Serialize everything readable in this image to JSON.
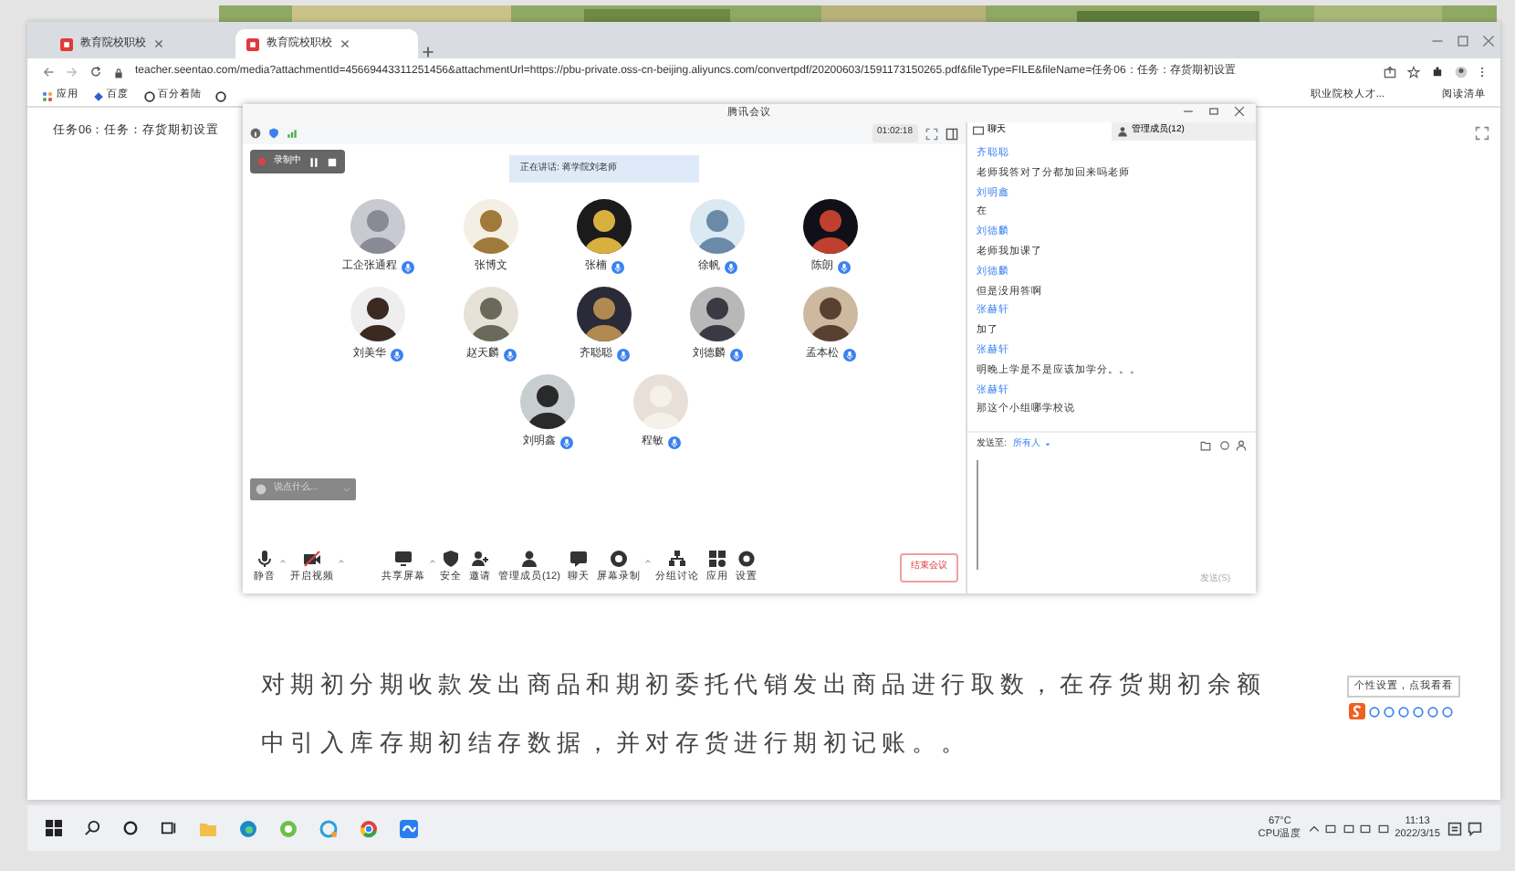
{
  "browser": {
    "tabs": [
      {
        "title": "教育院校职校",
        "selected": false
      },
      {
        "title": "教育院校职校",
        "selected": true
      }
    ],
    "url": "teacher.seentao.com/media?attachmentId=45669443311251456&attachmentUrl=https://pbu-private.oss-cn-beijing.aliyuncs.com/convertpdf/20200603/1591173150265.pdf&fileType=FILE&fileName=任务06：任务：存货期初设置",
    "bookmarks": [
      "应用",
      "百度",
      "百分着陆"
    ],
    "bookmarks_right": [
      "职业院校人才...",
      "阅读清单"
    ]
  },
  "page": {
    "title": "任务06：任务：存货期初设置",
    "paragraph_lines": [
      "对期初分期收款发出商品和期初委托代销发出商品进行取数，在存货期初余额",
      "中引入库存期初结存数据，并对存货进行期初记账。。"
    ]
  },
  "meeting": {
    "title": "腾讯会议",
    "timer": "01:02:18",
    "recording": "录制中",
    "speaking": "正在讲话: 蒋学院刘老师",
    "participants": [
      {
        "name": "工企张通程",
        "mic": true
      },
      {
        "name": "张博文",
        "mic": false
      },
      {
        "name": "张楠",
        "mic": true
      },
      {
        "name": "徐帆",
        "mic": true
      },
      {
        "name": "陈朗",
        "mic": true
      },
      {
        "name": "刘美华",
        "mic": true
      },
      {
        "name": "赵天麟",
        "mic": true
      },
      {
        "name": "齐聪聪",
        "mic": true
      },
      {
        "name": "刘德麟",
        "mic": true
      },
      {
        "name": "孟本松",
        "mic": true
      },
      {
        "name": "刘明鑫",
        "mic": true
      },
      {
        "name": "程敏",
        "mic": true
      }
    ],
    "chat_placeholder": "说点什么...",
    "toolbar_left": [
      {
        "label": "静音",
        "has_menu": true
      },
      {
        "label": "开启视频",
        "has_menu": true
      }
    ],
    "toolbar_center": [
      {
        "label": "共享屏幕",
        "has_menu": true
      },
      {
        "label": "安全",
        "has_menu": false
      },
      {
        "label": "邀请",
        "has_menu": false
      },
      {
        "label": "管理成员(12)",
        "has_menu": false
      },
      {
        "label": "聊天",
        "has_menu": false
      },
      {
        "label": "屏幕录制",
        "has_menu": true
      },
      {
        "label": "分组讨论",
        "has_menu": false
      },
      {
        "label": "应用",
        "has_menu": false
      },
      {
        "label": "设置",
        "has_menu": false
      }
    ],
    "end_button": "结束会议"
  },
  "chat": {
    "tabs": [
      {
        "label": "聊天",
        "selected": true
      },
      {
        "label": "管理成员(12)",
        "selected": false
      }
    ],
    "messages": [
      {
        "sender": "齐聪聪",
        "text": "老师我答对了分都加回来吗老师"
      },
      {
        "sender": "刘明鑫",
        "text": "在"
      },
      {
        "sender": "刘德麟",
        "text": "老师我加课了"
      },
      {
        "sender": "刘德麟",
        "text": "但是没用答啊"
      },
      {
        "sender": "张赫轩",
        "text": "加了"
      },
      {
        "sender": "张赫轩",
        "text": "明晚上学是不是应该加学分。。。"
      },
      {
        "sender": "张赫轩",
        "text": "那这个小组哪学校说"
      }
    ],
    "send_to_label": "发送至:",
    "send_to": "所有人",
    "send_button": "发送(S)"
  },
  "ime": {
    "tooltip": "个性设置，点我看看"
  },
  "taskbar": {
    "temp": "67°C",
    "temp_label": "CPU温度",
    "time": "11:13",
    "date": "2022/3/15"
  }
}
